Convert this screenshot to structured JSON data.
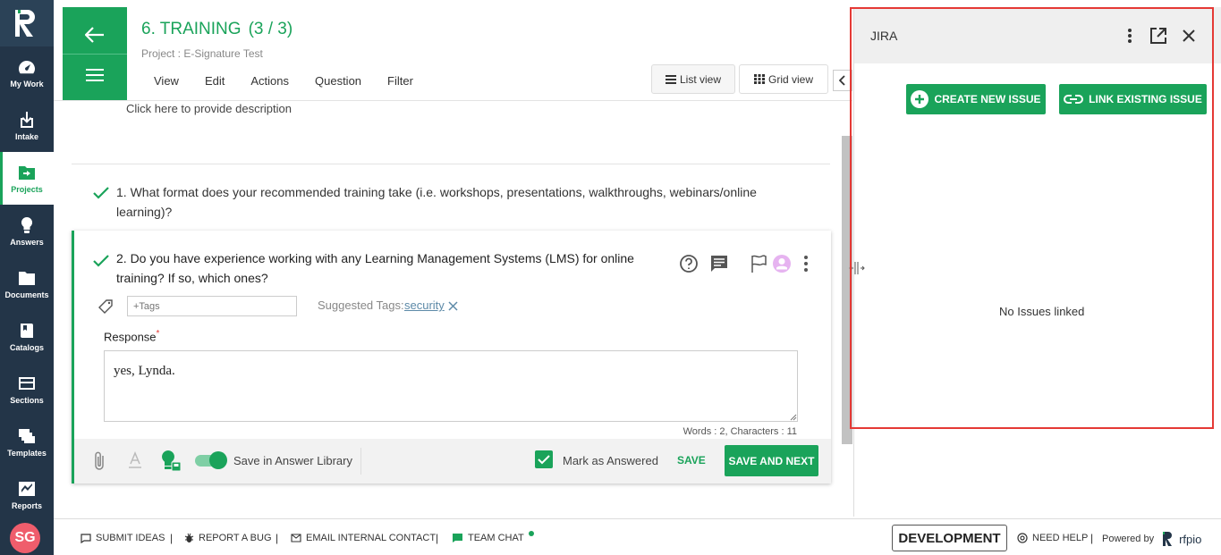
{
  "sidebar": {
    "items": [
      {
        "label": "My Work",
        "icon": "gauge-icon"
      },
      {
        "label": "Intake",
        "icon": "inbox-download-icon"
      },
      {
        "label": "Projects",
        "icon": "folder-arrow-icon"
      },
      {
        "label": "Answers",
        "icon": "lightbulb-icon"
      },
      {
        "label": "Documents",
        "icon": "folder-icon"
      },
      {
        "label": "Catalogs",
        "icon": "book-icon"
      },
      {
        "label": "Sections",
        "icon": "section-icon"
      },
      {
        "label": "Templates",
        "icon": "templates-icon"
      },
      {
        "label": "Reports",
        "icon": "chart-icon"
      }
    ],
    "active": "Projects",
    "avatar_initials": "SG"
  },
  "header": {
    "title": "6. TRAINING",
    "count": "(3 / 3)",
    "project": "Project : E-Signature Test",
    "menu": [
      "View",
      "Edit",
      "Actions",
      "Question",
      "Filter"
    ],
    "list_view": "List view",
    "grid_view": "Grid view"
  },
  "section": {
    "description_prompt": "Click here to provide description"
  },
  "questions": [
    {
      "text": "1. What format does your recommended training take (i.e. workshops, presentations, walkthroughs, webinars/online learning)?"
    },
    {
      "text": "2. Do you have experience working with any Learning Management Systems (LMS) for online training? If so, which ones?"
    }
  ],
  "editor": {
    "tags_placeholder": "+Tags",
    "suggested_label": "Suggested Tags:",
    "suggested_tag": "security",
    "response_label": "Response",
    "required_mark": "*",
    "response_value": "yes, Lynda.",
    "word_count": "Words : 2, Characters : 11",
    "save_library_label": "Save in Answer Library",
    "mark_answered_label": "Mark as Answered",
    "save_label": "SAVE",
    "save_next_label": "SAVE AND NEXT"
  },
  "jira": {
    "title": "JIRA",
    "create_label": "CREATE NEW ISSUE",
    "link_label": "LINK EXISTING ISSUE",
    "empty_text": "No Issues linked"
  },
  "footer": {
    "submit_ideas": "SUBMIT IDEAS",
    "report_bug": "REPORT A BUG",
    "email_contact": "EMAIL INTERNAL CONTACT",
    "team_chat": "TEAM CHAT",
    "environment": "DEVELOPMENT",
    "need_help": "NEED HELP",
    "powered_by": "Powered by",
    "brand": "rfpio"
  },
  "colors": {
    "accent": "#1aa35a",
    "sidebar": "#233548",
    "highlight": "#e53935"
  }
}
